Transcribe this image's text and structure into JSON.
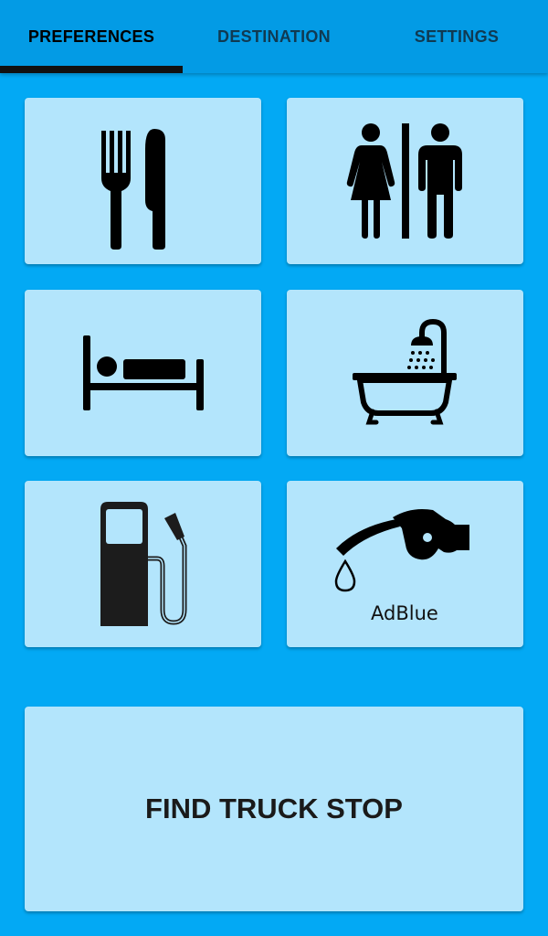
{
  "tabs": [
    {
      "label": "PREFERENCES",
      "active": true
    },
    {
      "label": "DESTINATION",
      "active": false
    },
    {
      "label": "SETTINGS",
      "active": false
    }
  ],
  "tiles": [
    {
      "icon": "restaurant-icon"
    },
    {
      "icon": "restroom-icon"
    },
    {
      "icon": "bed-icon"
    },
    {
      "icon": "shower-bath-icon"
    },
    {
      "icon": "fuel-pump-icon"
    },
    {
      "icon": "adblue-nozzle-icon",
      "caption": "AdBlue"
    }
  ],
  "find_button": {
    "label": "FIND TRUCK STOP"
  },
  "colors": {
    "background": "#03A9F4",
    "tab_bar": "#039BE5",
    "tile": "#B3E5FC",
    "icon": "#000000"
  }
}
